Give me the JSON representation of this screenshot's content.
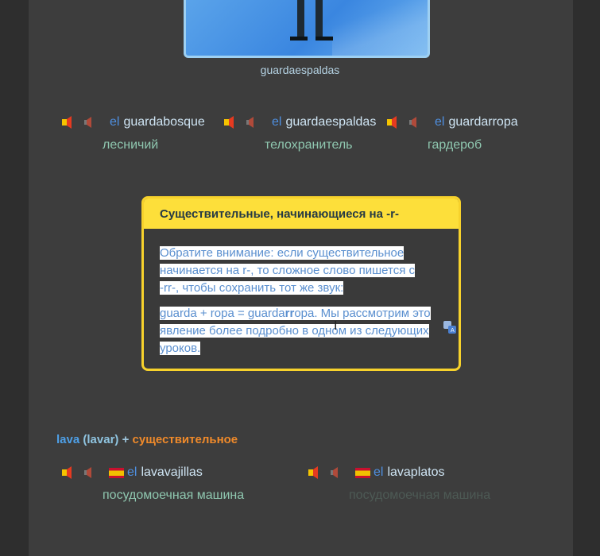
{
  "image": {
    "caption": "guardaespaldas"
  },
  "vocab_row1": [
    {
      "article": "el",
      "word": "guardabosque",
      "translation": "лесничий"
    },
    {
      "article": "el",
      "word": "guardaespaldas",
      "translation": "телохранитель"
    },
    {
      "article": "el",
      "word": "guardarropa",
      "translation": "гардероб"
    }
  ],
  "rule": {
    "title": "Существительные, начинающиеся на -r-",
    "p1_l1": "Обратите внимание: если существительное",
    "p1_l2": "начинается на r-, то сложное слово пишется с",
    "p1_l3": "-rr-, чтобы сохранить тот же звук:",
    "p2_l1_a": "guarda + ropa = guarda",
    "p2_l1_b": "rr",
    "p2_l1_c": "opa. Мы рассмотрим это",
    "p2_l2": "явление более подробно в одном из следующих",
    "p2_l3": "уроков."
  },
  "heading2": {
    "lava": "lava",
    "lavar": "(lavar)",
    "plus": "+",
    "noun": "существительное"
  },
  "vocab_row2": [
    {
      "article": "el",
      "word": "lavavajillas",
      "translation": "посудомоечная машина"
    },
    {
      "article": "el",
      "word": "lavaplatos",
      "translation": "посудомоечная машина"
    }
  ],
  "colors": {
    "accent_yellow": "#fddf3a",
    "article_blue": "#4e8fe0",
    "translation_green": "#8fc8b0"
  }
}
